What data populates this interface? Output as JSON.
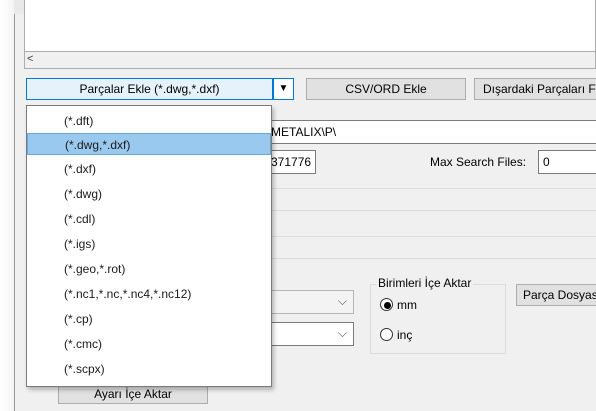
{
  "scroll": {
    "left_arrow": "<"
  },
  "toolbar": {
    "add_parts_combo_label": "Parçalar Ekle (*.dwg,*.dxf)",
    "combo_arrow": "▼",
    "csv_button_label": "CSV/ORD Ekle",
    "external_parts_button_label": "Dışardaki Parçaları Fi"
  },
  "path_field": {
    "value": "METALIX\\P\\"
  },
  "number_field": {
    "value": "371776"
  },
  "max_search": {
    "label": "Max Search Files:",
    "value": "0"
  },
  "units_group": {
    "title": "Birimleri İçe Aktar",
    "options": [
      {
        "label": "mm",
        "checked": true
      },
      {
        "label": "inç",
        "checked": false
      }
    ]
  },
  "part_file_button_label": "Parça Dosyas",
  "import_settings_button_label": "Ayarı İçe Aktar",
  "dropdown": {
    "items": [
      {
        "label": "(*.dft)",
        "selected": false
      },
      {
        "label": "(*.dwg,*.dxf)",
        "selected": true
      },
      {
        "label": "(*.dxf)",
        "selected": false
      },
      {
        "label": "(*.dwg)",
        "selected": false
      },
      {
        "label": "(*.cdl)",
        "selected": false
      },
      {
        "label": "(*.igs)",
        "selected": false
      },
      {
        "label": "(*.geo,*.rot)",
        "selected": false
      },
      {
        "label": "(*.nc1,*.nc,*.nc4,*.nc12)",
        "selected": false
      },
      {
        "label": "(*.cp)",
        "selected": false
      },
      {
        "label": "(*.cmc)",
        "selected": false
      },
      {
        "label": "(*.scpx)",
        "selected": false
      }
    ]
  }
}
